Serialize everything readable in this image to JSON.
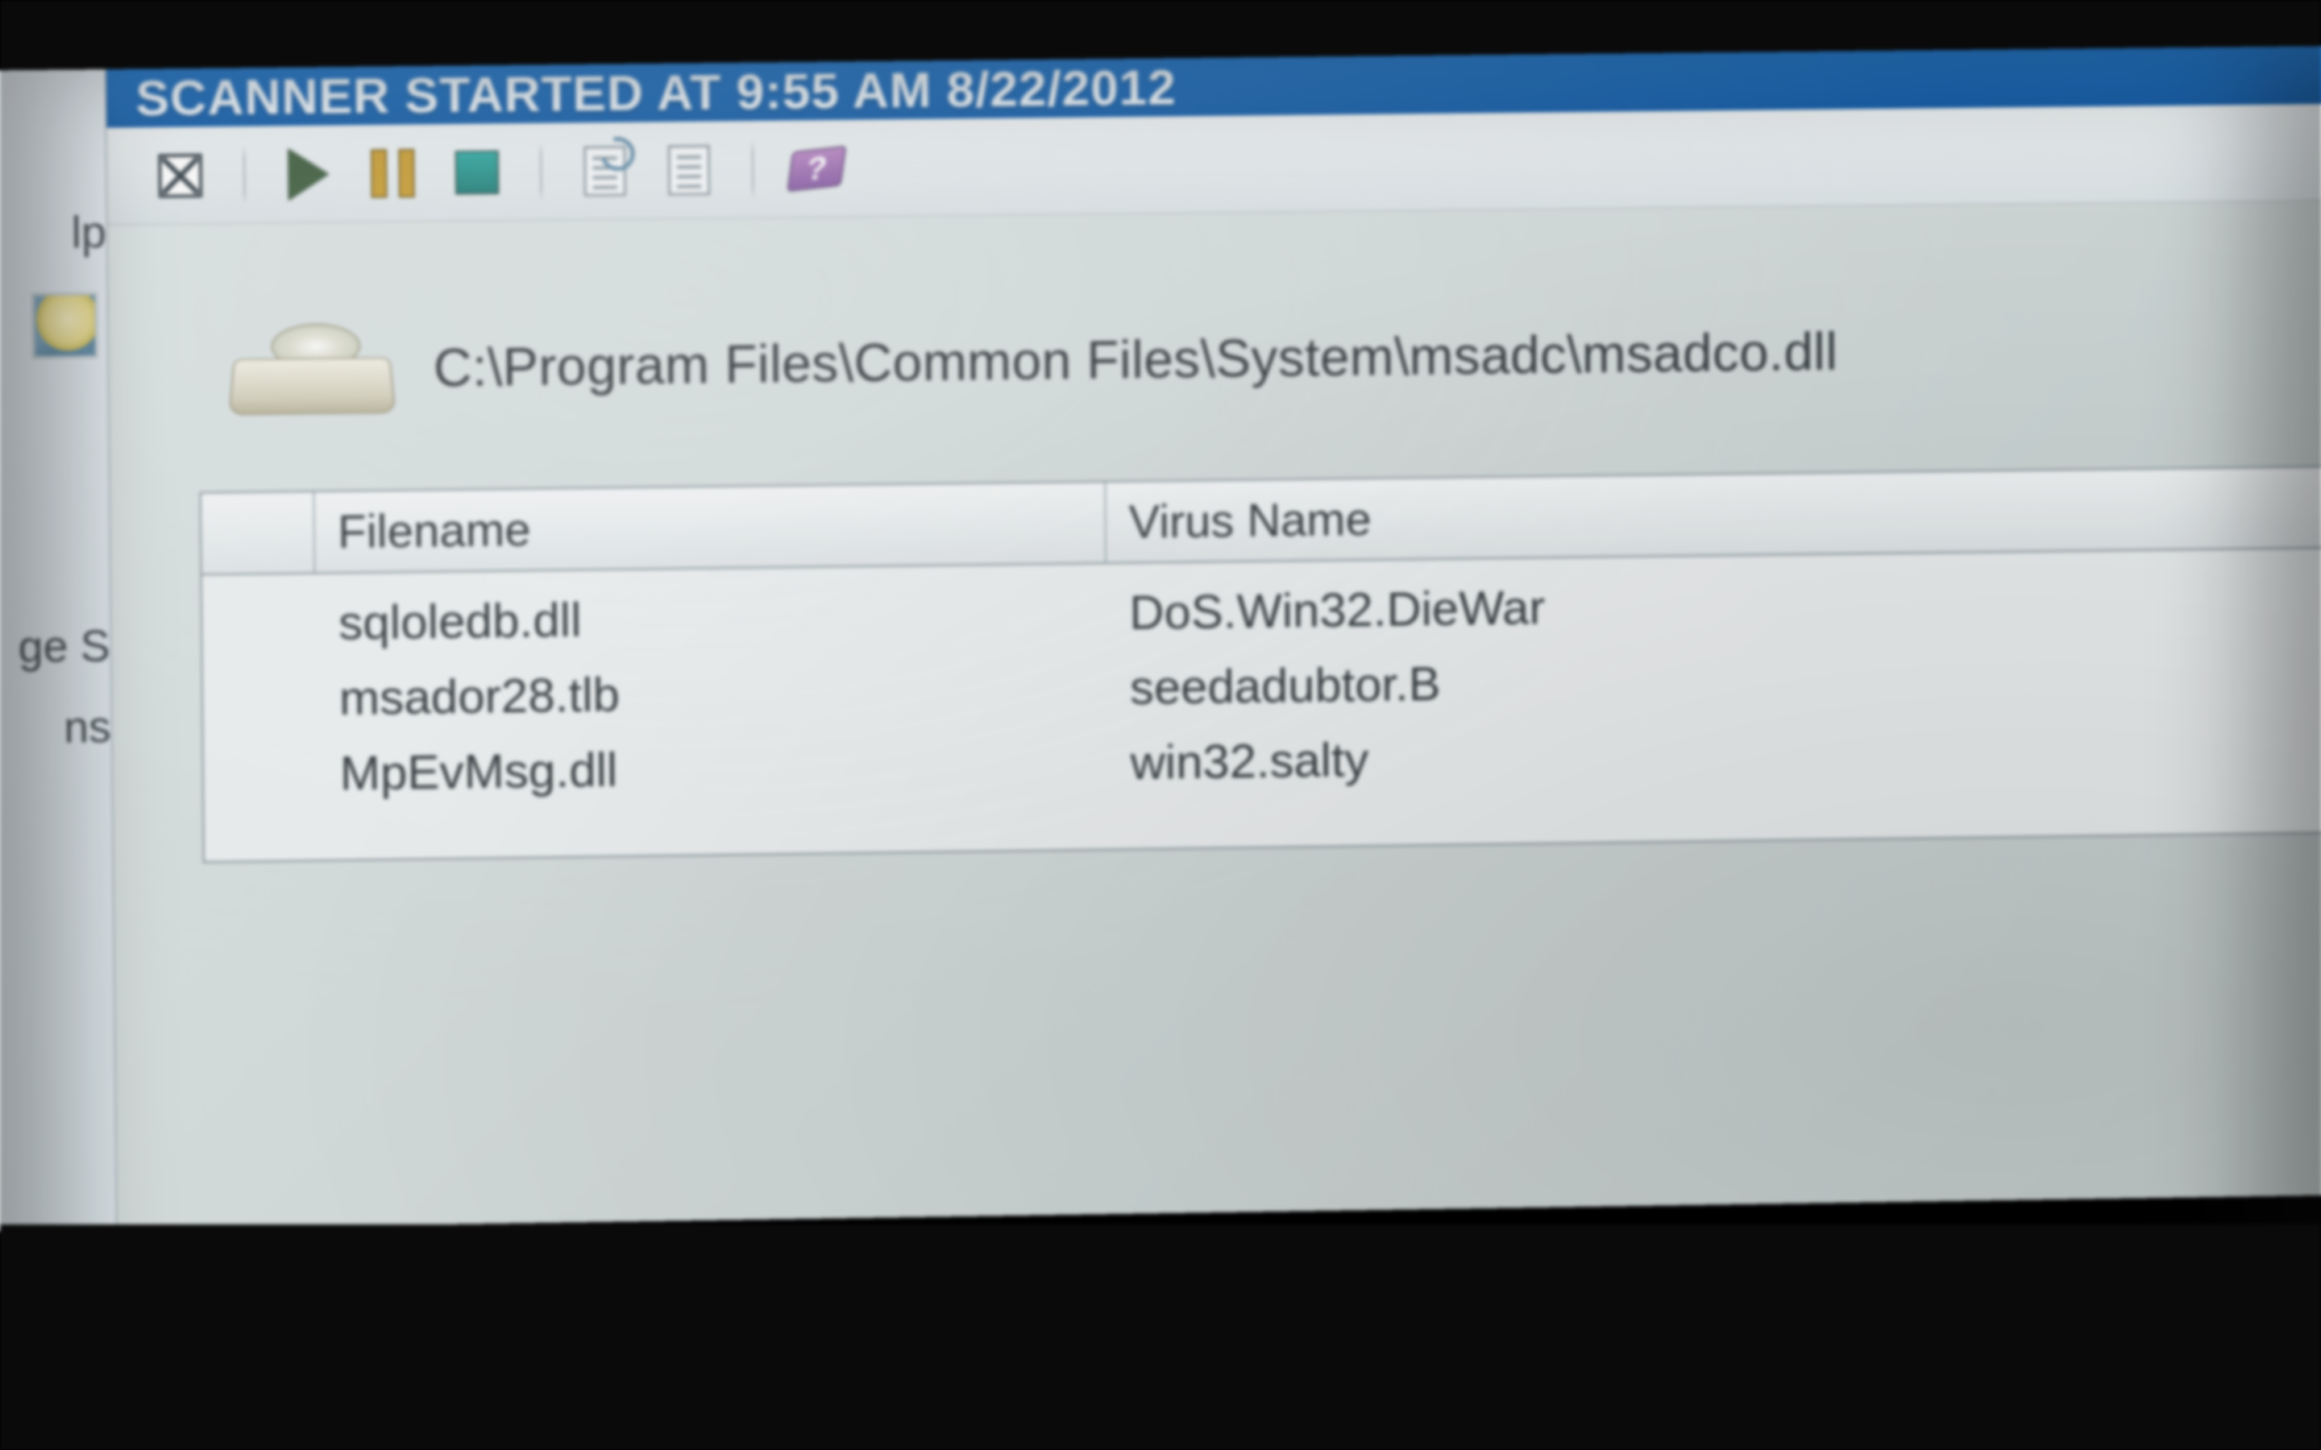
{
  "titlebar": {
    "text": "SCANNER STARTED AT 9:55 AM  8/22/2012"
  },
  "toolbar": {
    "close_name": "close",
    "play_name": "play",
    "pause_name": "pause",
    "stop_name": "stop",
    "report_name": "report",
    "log_name": "log",
    "help_name": "help",
    "help_glyph": "?"
  },
  "sidebar": {
    "fragments": [
      "lp",
      "ge S",
      "ns"
    ]
  },
  "scan": {
    "current_path": "C:\\Program Files\\Common Files\\System\\msadc\\msadco.dll"
  },
  "table": {
    "headers": {
      "icon": "",
      "filename": "Filename",
      "virus": "Virus Name"
    },
    "rows": [
      {
        "filename": "sqloledb.dll",
        "virus": "DoS.Win32.DieWar"
      },
      {
        "filename": "msador28.tlb",
        "virus": "seedadubtor.B"
      },
      {
        "filename": "MpEvMsg.dll",
        "virus": "win32.salty"
      }
    ]
  }
}
